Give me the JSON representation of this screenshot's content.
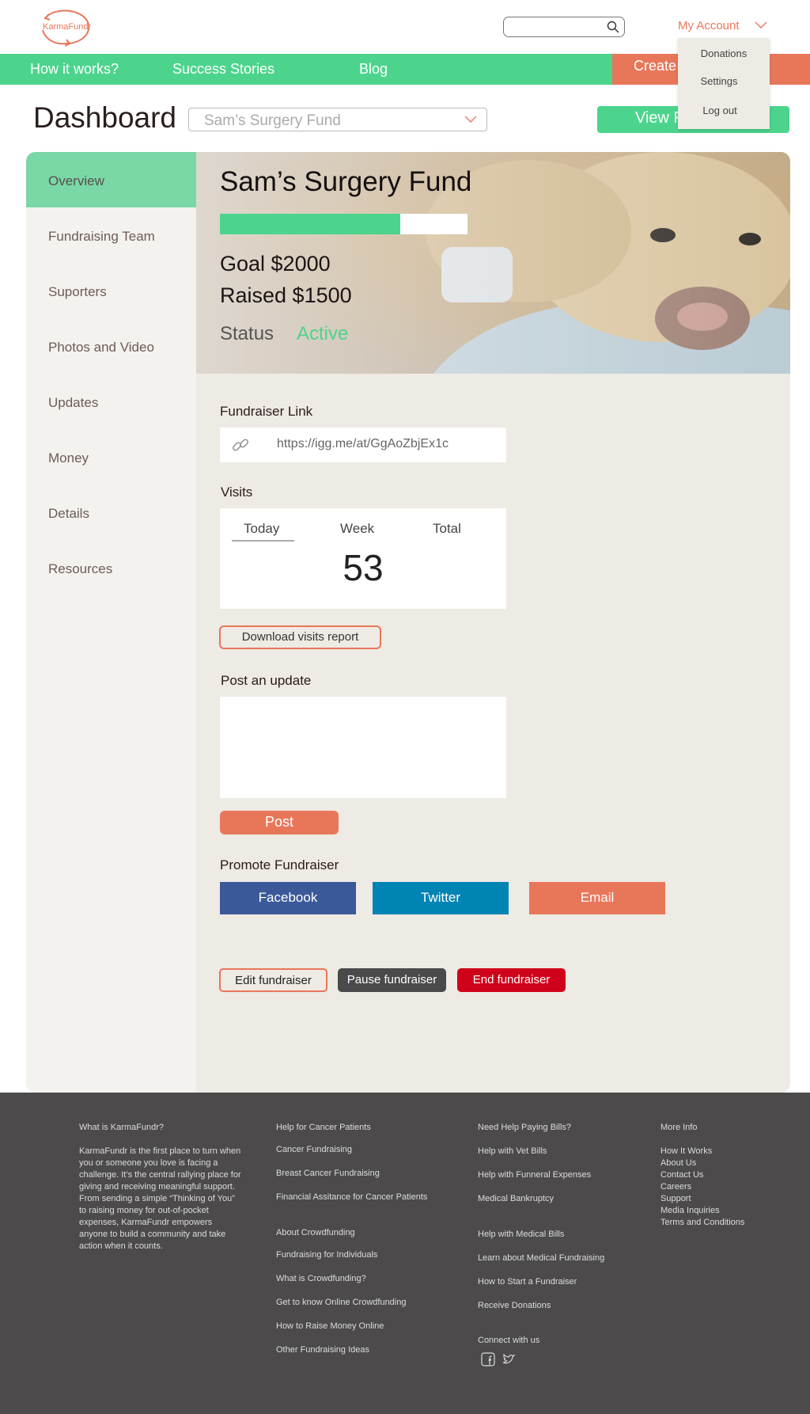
{
  "header": {
    "logo_text": "KarmaFundr",
    "search": {
      "placeholder": "",
      "value": ""
    },
    "account_label": "My Account",
    "account_menu": [
      "Donations",
      "Settings",
      "Log out"
    ]
  },
  "nav": {
    "items": [
      "How it works?",
      "Success Stories",
      "Blog"
    ],
    "create_label": "Create a Fundraiser"
  },
  "dashboard": {
    "title": "Dashboard",
    "selected_fund": "Sam’s Surgery Fund",
    "view_label": "View Fundraiser"
  },
  "sidebar": {
    "items": [
      "Overview",
      "Fundraising Team",
      "Suporters",
      "Photos and Video",
      "Updates",
      "Money",
      "Details",
      "Resources"
    ],
    "active_index": 0
  },
  "hero": {
    "title": "Sam’s Surgery Fund",
    "progress_fraction": 0.73,
    "goal": "Goal $2000",
    "raised": "Raised $1500",
    "status_label": "Status",
    "status_value": "Active"
  },
  "content": {
    "link_label": "Fundraiser Link",
    "link_url": "https://igg.me/at/GgAoZbjEx1c",
    "visits_label": "Visits",
    "visits_tabs": [
      "Today",
      "Week",
      "Total"
    ],
    "visits_active_tab": "Today",
    "visits_count": "53",
    "download_label": "Download visits report",
    "update_label": "Post an update",
    "update_value": "",
    "post_label": "Post",
    "promote_label": "Promote Fundraiser",
    "social": [
      "Facebook",
      "Twitter",
      "Email"
    ],
    "actions": [
      "Edit fundraiser",
      "Pause fundraiser",
      "End fundraiser"
    ]
  },
  "colors": {
    "green": "#4cd48d",
    "coral": "#e8775a",
    "facebook": "#3b5998",
    "twitter": "#0084b4",
    "danger": "#d0021b",
    "dark_button": "#4a4a4a"
  },
  "footer": {
    "about_heading": "What is KarmaFundr?",
    "about_text": "KarmaFundr is the first place to turn when you or someone you love is facing a challenge. It’s the central rallying place for giving and receiving meaningful support. From sending a simple “Thinking of You” to raising money for out-of-pocket expenses, KarmaFundr empowers anyone to build a community and take action when it counts.",
    "col2_group1": [
      "Help for Cancer Patients",
      "Cancer Fundraising",
      "Breast Cancer Fundraising",
      "Financial Assitance for Cancer Patients"
    ],
    "col2_group2": [
      "About Crowdfunding",
      "Fundraising for Individuals",
      "What is Crowdfunding?",
      "Get to know Online Crowdfunding",
      "How to Raise Money Online",
      "Other Fundraising Ideas"
    ],
    "col3_group1": [
      "Need Help Paying Bills?",
      "Help with Vet Bills",
      "Help with Funneral Expenses",
      "Medical Bankruptcy"
    ],
    "col3_group2": [
      "Help with Medical Bills",
      "Learn about Medical Fundraising",
      "How to Start a Fundraiser",
      "Receive Donations"
    ],
    "connect_label": "Connect with us",
    "more_heading": "More Info",
    "more_links": [
      "How It Works",
      "About Us",
      "Contact Us",
      "Careers",
      "Support",
      "Media Inquiries",
      "Terms and Conditions"
    ]
  }
}
